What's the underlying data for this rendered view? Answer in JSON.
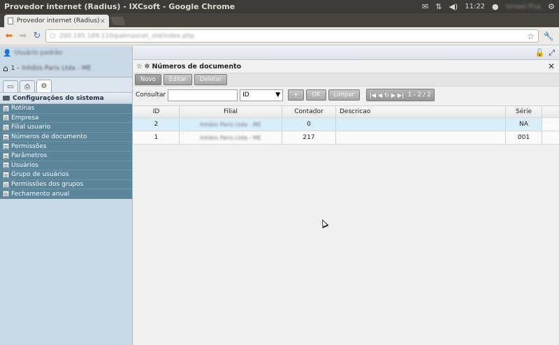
{
  "os": {
    "window_title": "Provedor internet (Radius) - IXCsoft - Google Chrome",
    "time": "11:22",
    "user": "Ismael Pisa"
  },
  "browser": {
    "tab_title": "Provedor internet (Radius)",
    "tab_close": "×",
    "url": "200.195.189.110/palmasnet_old/index.php"
  },
  "sidebar": {
    "user_label": "Usuário padrão",
    "company_prefix": "1 -",
    "company_name": "Inhibis Paris Ltda - ME",
    "section_title": "Configurações do sistema",
    "items": [
      {
        "label": "Rotinas"
      },
      {
        "label": "Empresa"
      },
      {
        "label": "Filial usuario"
      },
      {
        "label": "Números de documento"
      },
      {
        "label": "Permissões"
      },
      {
        "label": "Parâmetros"
      },
      {
        "label": "Usuários"
      },
      {
        "label": "Grupo de usuários"
      },
      {
        "label": "Permissões dos grupos"
      },
      {
        "label": "Fechamento anual"
      }
    ]
  },
  "panel": {
    "title": "Números de documento",
    "actions": {
      "novo": "Novo",
      "editar": "Editar",
      "deletar": "Deletar"
    },
    "filter": {
      "label": "Consultar",
      "search_value": "",
      "field_selected": "ID",
      "plus_button": "+",
      "ok_button": "OK",
      "clear_button": "Limpar"
    },
    "pager": {
      "info": "1 - 2 / 2"
    }
  },
  "grid": {
    "columns": [
      "ID",
      "Filial",
      "Contador",
      "Descricao",
      "Série"
    ],
    "rows": [
      {
        "id": "2",
        "filial": "Inhibis Paris Ltda - ME",
        "contador": "0",
        "descricao": "",
        "serie": "NA"
      },
      {
        "id": "1",
        "filial": "Inhibis Paris Ltda - ME",
        "contador": "217",
        "descricao": "",
        "serie": "001"
      }
    ]
  }
}
